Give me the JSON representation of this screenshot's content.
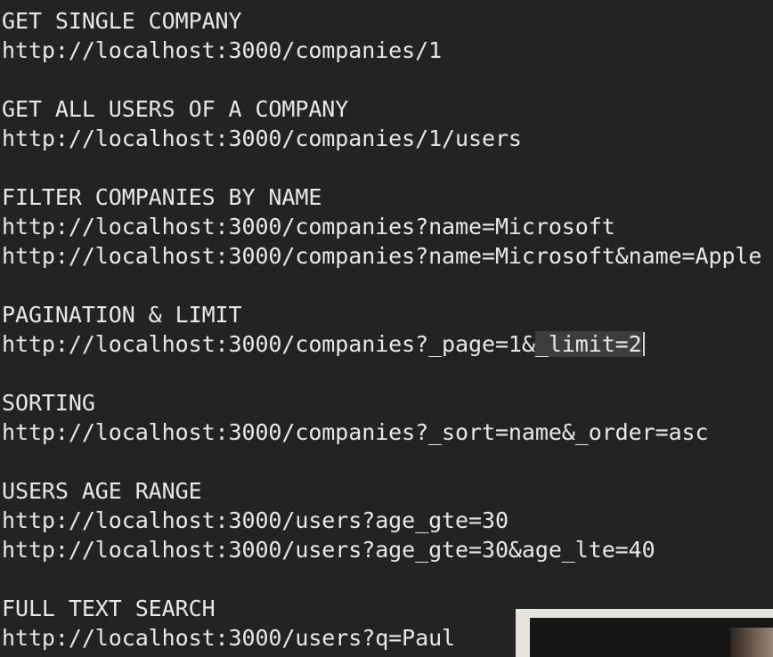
{
  "sections": [
    {
      "heading": "GET SINGLE COMPANY",
      "urls": [
        "http://localhost:3000/companies/1"
      ]
    },
    {
      "heading": "GET ALL USERS OF A COMPANY",
      "urls": [
        "http://localhost:3000/companies/1/users"
      ]
    },
    {
      "heading": "FILTER COMPANIES BY NAME",
      "urls": [
        "http://localhost:3000/companies?name=Microsoft",
        "http://localhost:3000/companies?name=Microsoft&name=Apple"
      ]
    },
    {
      "heading": "PAGINATION & LIMIT",
      "url_prefix": "http://localhost:3000/companies?_page=1&",
      "url_selected": "_limit=2"
    },
    {
      "heading": "SORTING",
      "urls": [
        "http://localhost:3000/companies?_sort=name&_order=asc"
      ]
    },
    {
      "heading": "USERS AGE RANGE",
      "urls": [
        "http://localhost:3000/users?age_gte=30",
        "http://localhost:3000/users?age_gte=30&age_lte=40"
      ]
    },
    {
      "heading": "FULL TEXT SEARCH",
      "urls": [
        "http://localhost:3000/users?q=Paul"
      ]
    }
  ]
}
